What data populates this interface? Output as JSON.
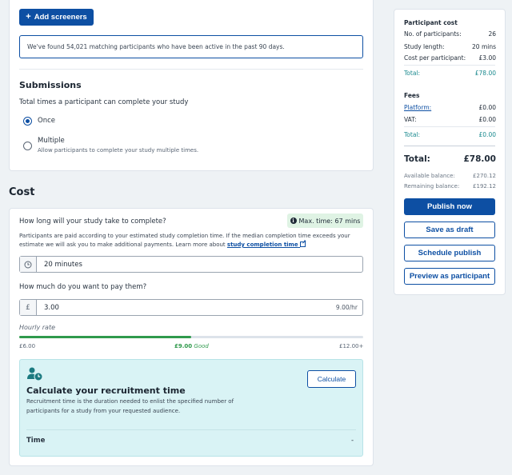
{
  "screeners": {
    "add_label": "Add screeners",
    "match_text": "We've found 54,021 matching participants who have been active in the past 90 days."
  },
  "submissions": {
    "title": "Submissions",
    "question": "Total times a participant can complete your study",
    "options": [
      {
        "label": "Once",
        "selected": true,
        "description": ""
      },
      {
        "label": "Multiple",
        "selected": false,
        "description": "Allow participants to complete your study multiple times."
      }
    ]
  },
  "cost": {
    "title": "Cost",
    "duration_question": "How long will your study take to complete?",
    "max_badge": "Max. time: 67 mins",
    "info_line1": "Participants are paid according to your estimated study completion time. If the median completion time exceeds your",
    "info_line2": "estimate we will ask you to make additional payments. Learn more about",
    "info_link": "study completion time",
    "duration_value": "20 minutes",
    "pay_question": "How much do you want to pay them?",
    "currency_symbol": "£",
    "pay_value": "3.00",
    "pay_rate_suffix": "9.00/hr",
    "hourly_rate_label": "Hourly rate",
    "rate_min": "£6.00",
    "rate_current": "£9.00",
    "rate_quality": "Good",
    "rate_max": "£12.00+",
    "rate_fill_fraction": 0.5
  },
  "recruitment": {
    "title": "Calculate your recruitment time",
    "description_line1": "Recruitment time is the duration needed to enlist the specified number of",
    "description_line2": "participants for a study from your requested audience.",
    "button": "Calculate",
    "time_label": "Time",
    "time_value": "-"
  },
  "summary": {
    "participant_cost_title": "Participant cost",
    "rows": [
      {
        "label": "No. of participants:",
        "value": "26"
      },
      {
        "label": "Study length:",
        "value": "20 mins"
      },
      {
        "label": "Cost per participant:",
        "value": "£3.00"
      }
    ],
    "participant_total_label": "Total:",
    "participant_total_value": "£78.00",
    "fees_title": "Fees",
    "fees_rows": [
      {
        "label": "Platform:",
        "value": "£0.00"
      },
      {
        "label": "VAT:",
        "value": "£0.00"
      }
    ],
    "fees_total_label": "Total:",
    "fees_total_value": "£0.00",
    "grand_total_label": "Total:",
    "grand_total_value": "£78.00",
    "available_label": "Available balance:",
    "available_value": "£270.12",
    "remaining_label": "Remaining balance:",
    "remaining_value": "£192.12",
    "publish_now": "Publish now",
    "save_draft": "Save as draft",
    "schedule_publish": "Schedule publish",
    "preview": "Preview as participant"
  },
  "colors": {
    "primary": "#0d4fa3",
    "good": "#2f9a4c",
    "teal": "#1b8a8f",
    "recruit_bg": "#d9f3f5"
  }
}
